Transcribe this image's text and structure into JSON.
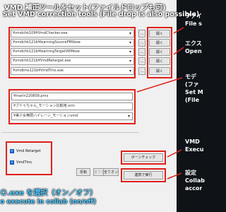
{
  "banner_top": {
    "title_jp": "VMD 補正ツールをセット(ファイルドロップも可)",
    "title_en": "Set VMD correction tools (File drop is also possible)"
  },
  "tool_rows": [
    {
      "path": "¥vmdchk109¥VmdChecker.exe",
      "browse": "...",
      "open": "開く"
    },
    {
      "path": "¥vmdchk121b¥learningSourcePMXexe",
      "browse": "...",
      "open": "開く"
    },
    {
      "path": "¥vmdchk121b¥learningTargetVRMexe",
      "browse": "...",
      "open": "開く"
    },
    {
      "path": "¥vmdchk121b¥VmdRetarget.exe",
      "browse": "...",
      "open": "開く"
    },
    {
      "path": "¥vmdtms121b¥VmdTms.exe",
      "browse": "...",
      "open": "開く"
    }
  ],
  "model_rows": [
    {
      "path": "¥marin220809.pmx"
    },
    {
      "path": "¥ブドゥちゃん_モーション比較用.vrm"
    },
    {
      "path": "¥美少女無限ハイレーン_モーションvmd"
    }
  ],
  "checkboxes": [
    {
      "label": "Vmd Retarget",
      "checked": true
    },
    {
      "label": "VmdTms",
      "checked": true
    }
  ],
  "bottom_buttons": {
    "invert": "反転",
    "all_off": "全てオフ",
    "all_on": "全てオン"
  },
  "action_buttons": {
    "bone_check": "ボーンチェック",
    "run_collab": "連携で実行"
  },
  "banner_bottom": {
    "line1": "Ｏ.exe を選択（オン／オフ）",
    "line2": "o execute in collab (on/off)"
  },
  "right_annotations": [
    {
      "text": "ファイ",
      "color": "#ffffff"
    },
    {
      "text": "File s",
      "color": "#ffffff"
    },
    {
      "text": "エクス",
      "color": "#ffffff"
    },
    {
      "text": "Open",
      "color": "#ffffff"
    },
    {
      "text": "モデ",
      "color": "#ffffff"
    },
    {
      "text": "(ファ",
      "color": "#ffffff"
    },
    {
      "text": "Set M",
      "color": "#ffffff"
    },
    {
      "text": "(File",
      "color": "#ffffff"
    },
    {
      "text": "VMD",
      "color": "#ffffff"
    },
    {
      "text": "Execu",
      "color": "#ffffff"
    },
    {
      "text": "設定",
      "color": "#ffffff"
    },
    {
      "text": "Collab",
      "color": "#ffffff"
    },
    {
      "text": "accor",
      "color": "#ffffff"
    }
  ],
  "colors": {
    "highlight": "#e0201b",
    "banner_accent": "#4cc8ff",
    "checkbox": "#1f6fe0"
  }
}
